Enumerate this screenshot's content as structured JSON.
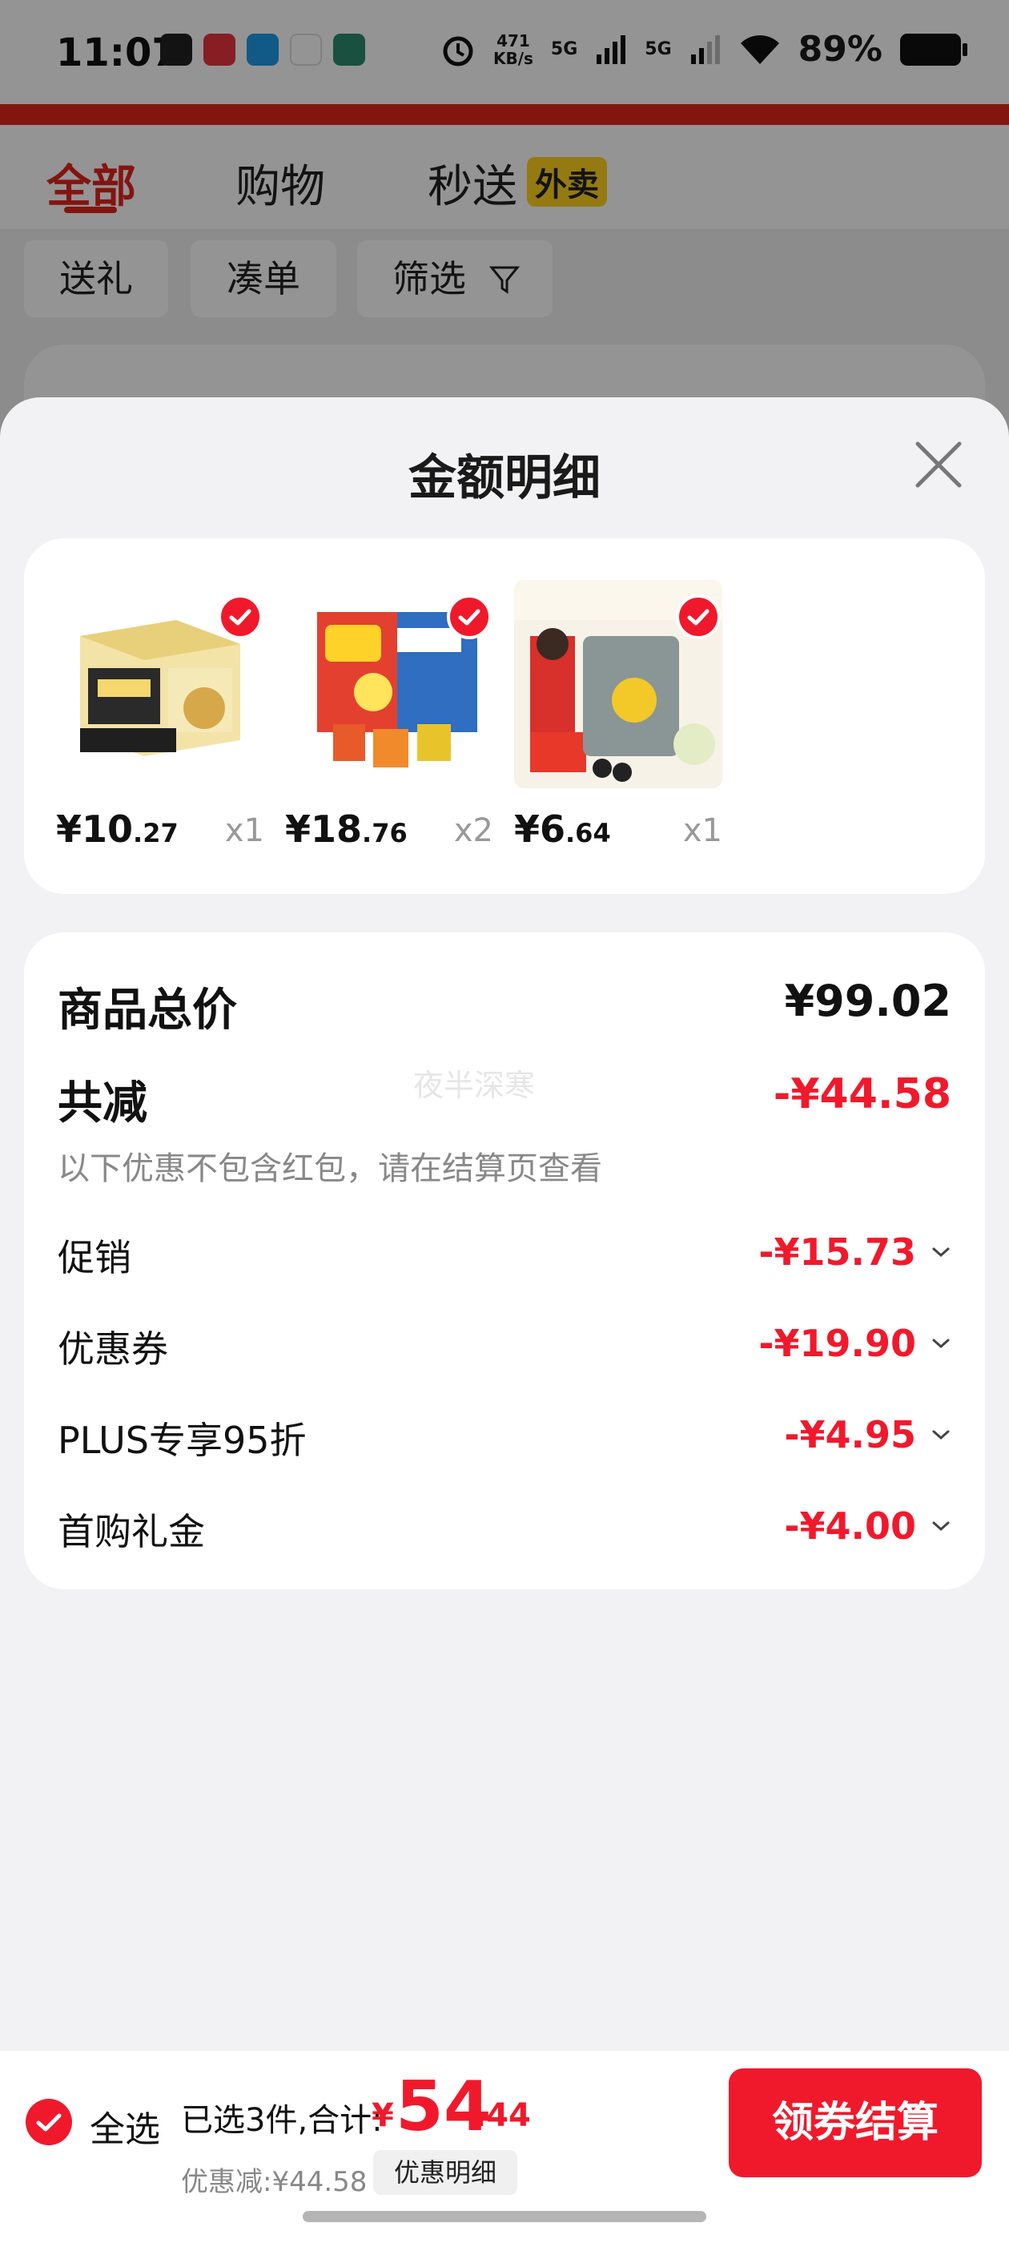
{
  "status_bar": {
    "time": "11:07",
    "net_speed_value": "471",
    "net_speed_unit": "KB/s",
    "sig1": "5G",
    "sig2": "5G",
    "battery": "89%",
    "icons": [
      "wechat-icon",
      "app-icon",
      "app-icon",
      "app-icon",
      "avatar-icon"
    ]
  },
  "background_page": {
    "tabs": [
      {
        "label": "全部",
        "active": true
      },
      {
        "label": "购物",
        "active": false
      },
      {
        "label": "秒送",
        "active": false
      }
    ],
    "waimai_badge": "外卖",
    "chips": [
      "送礼",
      "凑单",
      "筛选"
    ]
  },
  "sheet": {
    "title": "金额明细",
    "items": [
      {
        "price_int": "¥10",
        "price_dec": ".27",
        "qty": "x1",
        "checked": true
      },
      {
        "price_int": "¥18",
        "price_dec": ".76",
        "qty": "x2",
        "checked": true
      },
      {
        "price_int": "¥6",
        "price_dec": ".64",
        "qty": "x1",
        "checked": true
      }
    ],
    "total_label": "商品总价",
    "total_value": "¥99.02",
    "reduce_label": "共减",
    "reduce_value": "-¥44.58",
    "note": "以下优惠不包含红包，请在结算页查看",
    "watermark": "夜半深寒",
    "discounts": [
      {
        "label": "促销",
        "value": "-¥15.73"
      },
      {
        "label": "优惠券",
        "value": "-¥19.90"
      },
      {
        "label": "PLUS专享95折",
        "value": "-¥4.95"
      },
      {
        "label": "首购礼金",
        "value": "-¥4.00"
      }
    ]
  },
  "bottom_bar": {
    "select_all": "全选",
    "summary_label": "已选3件,合计:",
    "yen": "¥",
    "total_int": "54",
    "total_dec": ".44",
    "discount_label": "优惠减:¥44.58",
    "detail_button": "优惠明细",
    "checkout_button": "领券结算"
  },
  "colors": {
    "accent_red": "#f0192c",
    "jd_red": "#e1251b"
  }
}
